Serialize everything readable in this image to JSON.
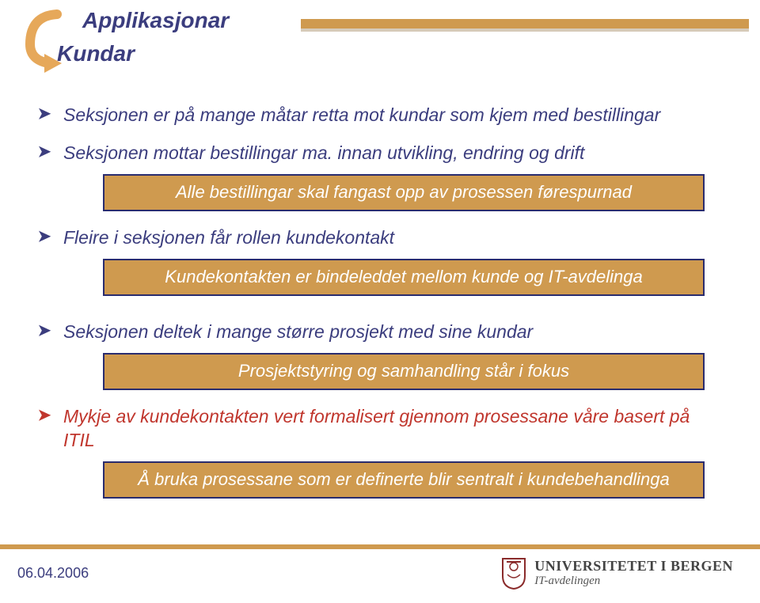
{
  "colors": {
    "accent_gold": "#cf9a4f",
    "headline_blue": "#3b3d7e",
    "red": "#c0362d",
    "callout_border": "#2a2c6e"
  },
  "header": {
    "line1": "Applikasjonar",
    "line2": "Kundar"
  },
  "arrow_icon": "curved-arrow-icon",
  "bullets": {
    "b1": "Seksjonen er på mange måtar retta mot kundar som kjem med bestillingar",
    "b2": "Seksjonen mottar bestillingar ma. innan utvikling, endring og drift",
    "c2": "Alle bestillingar skal fangast opp av prosessen førespurnad",
    "b3": "Fleire i seksjonen får rollen kundekontakt",
    "c3": "Kundekontakten er bindeleddet mellom kunde og IT-avdelinga",
    "b4": "Seksjonen deltek i mange større prosjekt med sine kundar",
    "c4": "Prosjektstyring og samhandling står i fokus",
    "b5": "Mykje av kundekontakten vert formalisert gjennom prosessane våre basert på ITIL",
    "c5": "Å bruka prosessane som er definerte blir sentralt i kundebehandlinga"
  },
  "footer": {
    "date": "06.04.2006",
    "university": "UNIVERSITETET I BERGEN",
    "dept": "IT-avdelingen"
  }
}
